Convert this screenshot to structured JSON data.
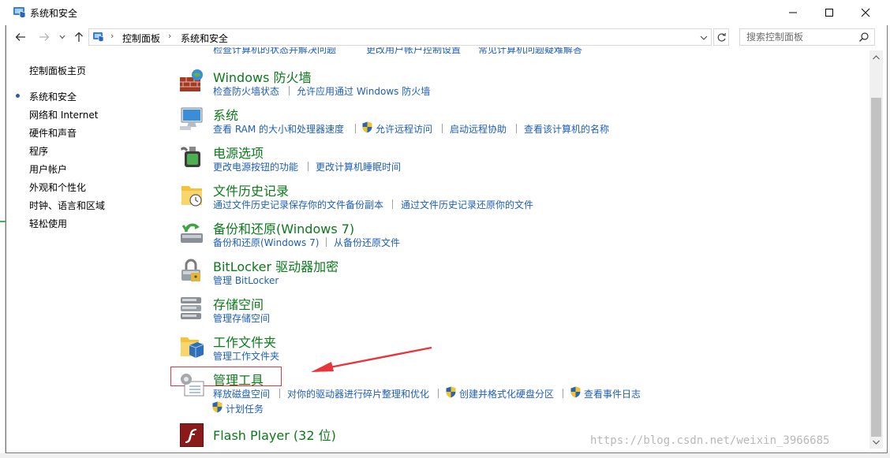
{
  "window": {
    "title": "系统和安全",
    "controls": {
      "minimize": "minimize-icon",
      "maximize": "maximize-icon",
      "close": "close-icon"
    }
  },
  "address_bar": {
    "breadcrumbs": [
      "控制面板",
      "系统和安全"
    ],
    "search_placeholder": "搜索控制面板"
  },
  "sidebar": {
    "home": "控制面板主页",
    "items": [
      {
        "label": "系统和安全",
        "selected": true
      },
      {
        "label": "网络和 Internet"
      },
      {
        "label": "硬件和声音"
      },
      {
        "label": "程序"
      },
      {
        "label": "用户帐户"
      },
      {
        "label": "外观和个性化"
      },
      {
        "label": "时钟、语言和区域"
      },
      {
        "label": "轻松使用"
      }
    ]
  },
  "partial_row": [
    "检查计算机的状态并解决问题",
    "更改用户帐户控制设置",
    "常见计算机问题疑难解答"
  ],
  "categories": [
    {
      "title": "Windows 防火墙",
      "icon": "firewall-icon",
      "links": [
        "检查防火墙状态",
        "允许应用通过 Windows 防火墙"
      ]
    },
    {
      "title": "系统",
      "icon": "system-icon",
      "links": [
        "查看 RAM 的大小和处理器速度",
        "允许远程访问",
        "启动远程协助",
        "查看该计算机的名称"
      ]
    },
    {
      "title": "电源选项",
      "icon": "power-options-icon",
      "links": [
        "更改电源按钮的功能",
        "更改计算机睡眠时间"
      ]
    },
    {
      "title": "文件历史记录",
      "icon": "file-history-icon",
      "links": [
        "通过文件历史记录保存你的文件备份副本",
        "通过文件历史记录还原你的文件"
      ]
    },
    {
      "title": "备份和还原(Windows 7)",
      "icon": "backup-restore-icon",
      "links": [
        "备份和还原(Windows 7)",
        "从备份还原文件"
      ]
    },
    {
      "title": "BitLocker 驱动器加密",
      "icon": "bitlocker-icon",
      "links": [
        "管理 BitLocker"
      ]
    },
    {
      "title": "存储空间",
      "icon": "storage-spaces-icon",
      "links": [
        "管理存储空间"
      ]
    },
    {
      "title": "工作文件夹",
      "icon": "work-folders-icon",
      "links": [
        "管理工作文件夹"
      ]
    },
    {
      "title": "管理工具",
      "icon": "admin-tools-icon",
      "links": [
        "释放磁盘空间",
        "对你的驱动器进行碎片整理和优化",
        "创建并格式化硬盘分区",
        "查看事件日志",
        "计划任务"
      ]
    },
    {
      "title": "Flash Player (32 位)",
      "icon": "flash-player-icon",
      "links": []
    }
  ],
  "colors": {
    "title_green": "#0b7a1a",
    "link_blue": "#1e5ebc",
    "annotation_red": "#e8343a"
  },
  "watermark": "https://blog.csdn.net/weixin_3966685"
}
